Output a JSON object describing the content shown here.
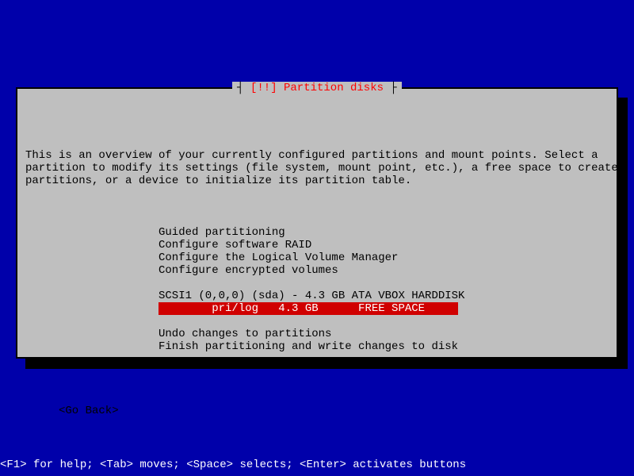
{
  "title": {
    "dash_left": "┤ ",
    "marker": "[!!]",
    "text": " Partition disks",
    "dash_right": " ├"
  },
  "intro": {
    "line1": "This is an overview of your currently configured partitions and mount points. Select a",
    "line2": "partition to modify its settings (file system, mount point, etc.), a free space to create",
    "line3": "partitions, or a device to initialize its partition table."
  },
  "menu": {
    "guided": "Guided partitioning",
    "raid": "Configure software RAID",
    "lvm": "Configure the Logical Volume Manager",
    "encrypted": "Configure encrypted volumes",
    "disk_header": "SCSI1 (0,0,0) (sda) - 4.3 GB ATA VBOX HARDDISK",
    "selected": "        pri/log   4.3 GB      FREE SPACE     ",
    "undo": "Undo changes to partitions",
    "finish": "Finish partitioning and write changes to disk"
  },
  "back": "<Go Back>",
  "footer": "<F1> for help; <Tab> moves; <Space> selects; <Enter> activates buttons"
}
